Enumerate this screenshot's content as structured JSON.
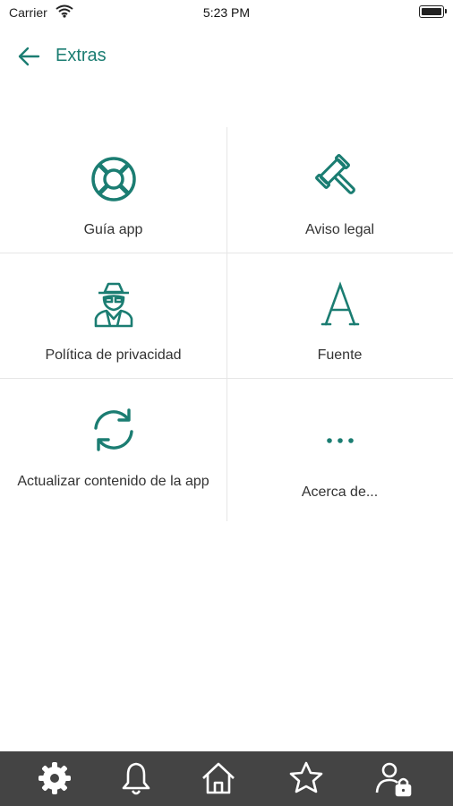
{
  "status_bar": {
    "carrier": "Carrier",
    "time": "5:23 PM"
  },
  "header": {
    "title": "Extras",
    "back_icon": "arrow-left-icon"
  },
  "menu_items": [
    {
      "label": "Guía app",
      "icon": "lifebuoy-icon"
    },
    {
      "label": "Aviso legal",
      "icon": "gavel-icon"
    },
    {
      "label": "Política de privacidad",
      "icon": "spy-icon"
    },
    {
      "label": "Fuente",
      "icon": "font-icon"
    },
    {
      "label": "Actualizar contenido de la app",
      "icon": "refresh-icon"
    },
    {
      "label": "Acerca de...",
      "icon": "more-dots-icon"
    }
  ],
  "tab_bar": {
    "items": [
      "gear-icon",
      "bell-icon",
      "home-icon",
      "star-icon",
      "user-lock-icon"
    ],
    "active": "gear-icon"
  },
  "colors": {
    "accent": "#1b7d72",
    "tab_bar_bg": "#444444",
    "tab_icon": "#ffffff"
  }
}
